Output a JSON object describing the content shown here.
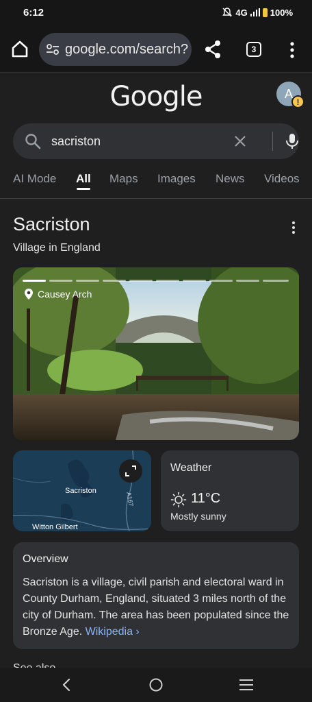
{
  "status": {
    "time": "6:12",
    "network": "4G",
    "battery": "100%"
  },
  "browser": {
    "url": "google.com/search?",
    "tab_count": "3"
  },
  "google": {
    "logo": "Google",
    "avatar_letter": "A",
    "avatar_warning": "!"
  },
  "search": {
    "query": "sacriston"
  },
  "tabs": [
    {
      "label": "AI Mode"
    },
    {
      "label": "All"
    },
    {
      "label": "Maps"
    },
    {
      "label": "Images"
    },
    {
      "label": "News"
    },
    {
      "label": "Videos"
    }
  ],
  "knowledge_panel": {
    "title": "Sacriston",
    "subtitle": "Village in England",
    "photo_place": "Causey Arch",
    "map": {
      "label_town": "Sacriston",
      "label_village": "Witton Gilbert",
      "label_road": "A167"
    },
    "weather": {
      "title": "Weather",
      "temperature": "11°C",
      "description": "Mostly sunny"
    },
    "overview": {
      "title": "Overview",
      "text": "Sacriston is a village, civil parish and electoral ward in County Durham, England, situated 3 miles north of the city of Durham. The area has been populated since the Bronze Age.",
      "link": "Wikipedia ›"
    },
    "see_also": "See also"
  },
  "icons": {
    "home": "home-icon",
    "site_settings": "tune-icon",
    "share": "share-icon",
    "menu": "more-vert-icon",
    "search": "search-icon",
    "clear": "close-icon",
    "mic": "mic-icon",
    "pin": "location-pin-icon",
    "expand": "expand-icon",
    "sun": "sun-icon"
  },
  "colors": {
    "background": "#1f1f1f",
    "card": "#303134",
    "link": "#8ab4f8",
    "url_box": "#3a3d45"
  }
}
